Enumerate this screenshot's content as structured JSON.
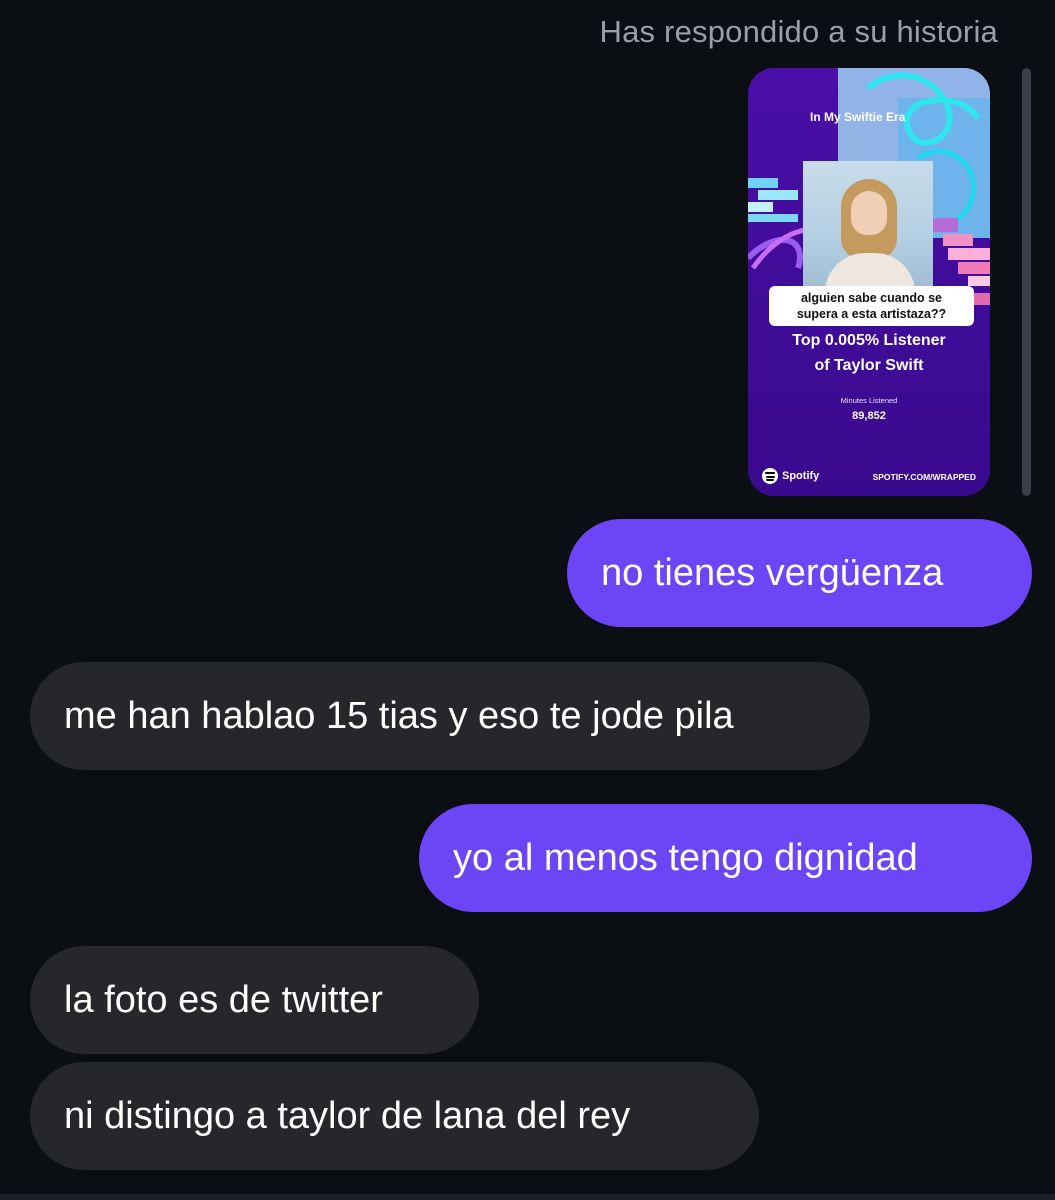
{
  "header": {
    "reply_note": "Has respondido a su historia"
  },
  "story": {
    "era_label": "In My Swiftie Era",
    "caption_line1": "alguien sabe cuando se",
    "caption_line2": "supera a esta artistaza??",
    "top_line1": "Top 0.005% Listener",
    "top_line2": "of Taylor Swift",
    "minutes_label": "Minutes Listened",
    "minutes_value": "89,852",
    "brand": "Spotify",
    "url": "SPOTIFY.COM/WRAPPED"
  },
  "messages": [
    {
      "direction": "out",
      "text": "no tienes vergüenza"
    },
    {
      "direction": "in",
      "text": "me han hablao 15 tias y eso te jode pila"
    },
    {
      "direction": "out",
      "text": "yo al menos tengo dignidad"
    },
    {
      "direction": "in",
      "text": "la foto es de twitter"
    },
    {
      "direction": "in",
      "text": "ni distingo a taylor de lana del rey"
    }
  ],
  "colors": {
    "background": "#0b0e13",
    "outgoing_bubble": "#6b45f6",
    "incoming_bubble": "#25272c",
    "story_purple": "#4b0fa8"
  }
}
